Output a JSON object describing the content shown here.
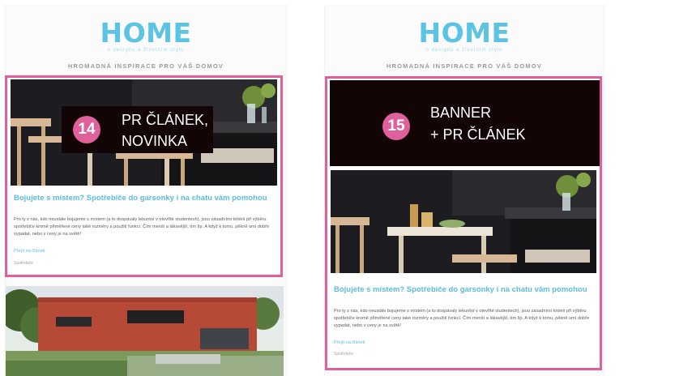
{
  "panels": [
    {
      "logo": "HOME",
      "logo_sub": "o designu a životním stylu",
      "tagline": "HROMADNÁ INSPIRACE PRO VÁŠ DOMOV",
      "label_number": "14",
      "label_line1": "PR ČLÁNEK,",
      "label_line2": "NOVINKA",
      "article_title": "Bojujete s místem? Spotřebiče do garsonky i na chatu vám pomohou",
      "article_body": "Pro ty z nás, kdo neustále bojujeme s místem (a to dospávaly lekuntní v otevřité studentech), jsou zásadními kritérii při výběru spotřebiče kromě přiměřené ceny také rozměry a použití funkcí. Čím menší a lákavější, tím líp. A když k tomu, pěkně umí dobře vypadat, nebo v ceny je na světě!",
      "article_link": "Přejít na článek",
      "article_meta": "Spotřebiče"
    },
    {
      "logo": "HOME",
      "logo_sub": "o designu a životním stylu",
      "tagline": "HROMADNÁ INSPIRACE PRO VÁŠ DOMOV",
      "label_number": "15",
      "label_line1": "BANNER",
      "label_line2": "+ PR ČLÁNEK",
      "article_title": "Bojujete s místem? Spotřebiče do garsonky i na chatu vám pomohou",
      "article_body": "Pro ty z nás, kdo neustále bojujeme s místem (a to dospávaly lekuntní v otevřité studentech), jsou zásadními kritérii při výběru spotřebiče kromě přiměřené ceny také rozměry a použití funkcí. Čím menší a lákavější, tím líp. A když k tomu, pěkně umí dobře vypadat, nebo v ceny je na světě!",
      "article_link": "Přejít na článek",
      "article_meta": "Spotřebiče"
    }
  ],
  "colors": {
    "accent_pink": "#e0609c",
    "logo_blue": "#5bc3e3",
    "banner_dark": "#130406"
  }
}
